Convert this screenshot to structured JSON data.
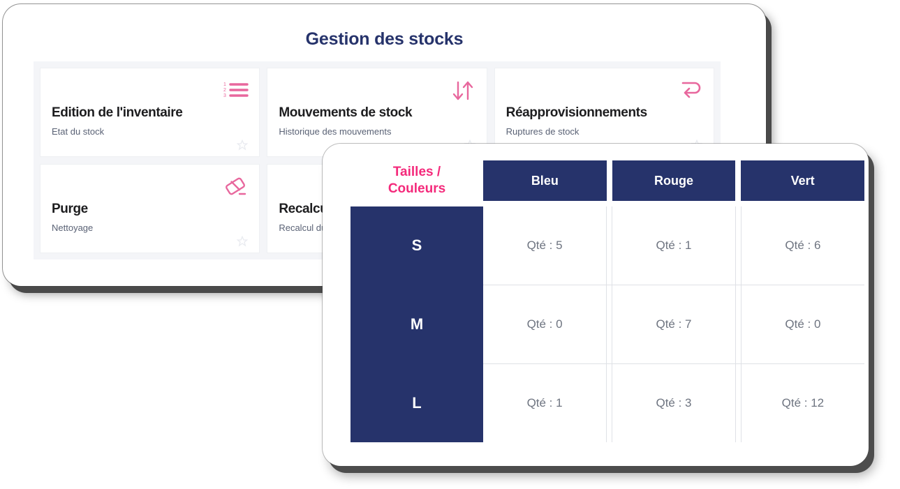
{
  "back_window": {
    "title": "Gestion des stocks",
    "title_color": "#26336b",
    "cards": [
      {
        "title": "Edition de l'inventaire",
        "subtitle": "Etat du stock",
        "icon": "numbered-list-icon",
        "star": "star-outline-icon"
      },
      {
        "title": "Mouvements de stock",
        "subtitle": "Historique des mouvements",
        "icon": "up-down-arrows-icon",
        "star": "star-outline-icon"
      },
      {
        "title": "Réapprovisionnements",
        "subtitle": "Ruptures de stock",
        "icon": "redo-arrow-icon",
        "star": "star-outline-icon"
      },
      {
        "title": "Purge",
        "subtitle": "Nettoyage",
        "icon": "eraser-icon",
        "star": "star-outline-icon"
      },
      {
        "title": "Recalcul",
        "subtitle": "Recalcul du stock",
        "icon": "calculator-icon",
        "star": "star-outline-icon"
      },
      {
        "title": "",
        "subtitle": "",
        "icon": "",
        "star": ""
      }
    ]
  },
  "front_window": {
    "corner_header": "Tailles / Couleurs",
    "corner_header_line1": "Tailles /",
    "corner_header_line2": "Couleurs",
    "accent_pink": "#f42a7b",
    "accent_navy": "#26336b",
    "columns": [
      "Bleu",
      "Rouge",
      "Vert"
    ],
    "rows": [
      {
        "size": "S",
        "cells": [
          "Qté : 5",
          "Qté : 1",
          "Qté : 6"
        ]
      },
      {
        "size": "M",
        "cells": [
          "Qté : 0",
          "Qté : 7",
          "Qté : 0"
        ]
      },
      {
        "size": "L",
        "cells": [
          "Qté : 1",
          "Qté : 3",
          "Qté : 12"
        ]
      }
    ]
  }
}
